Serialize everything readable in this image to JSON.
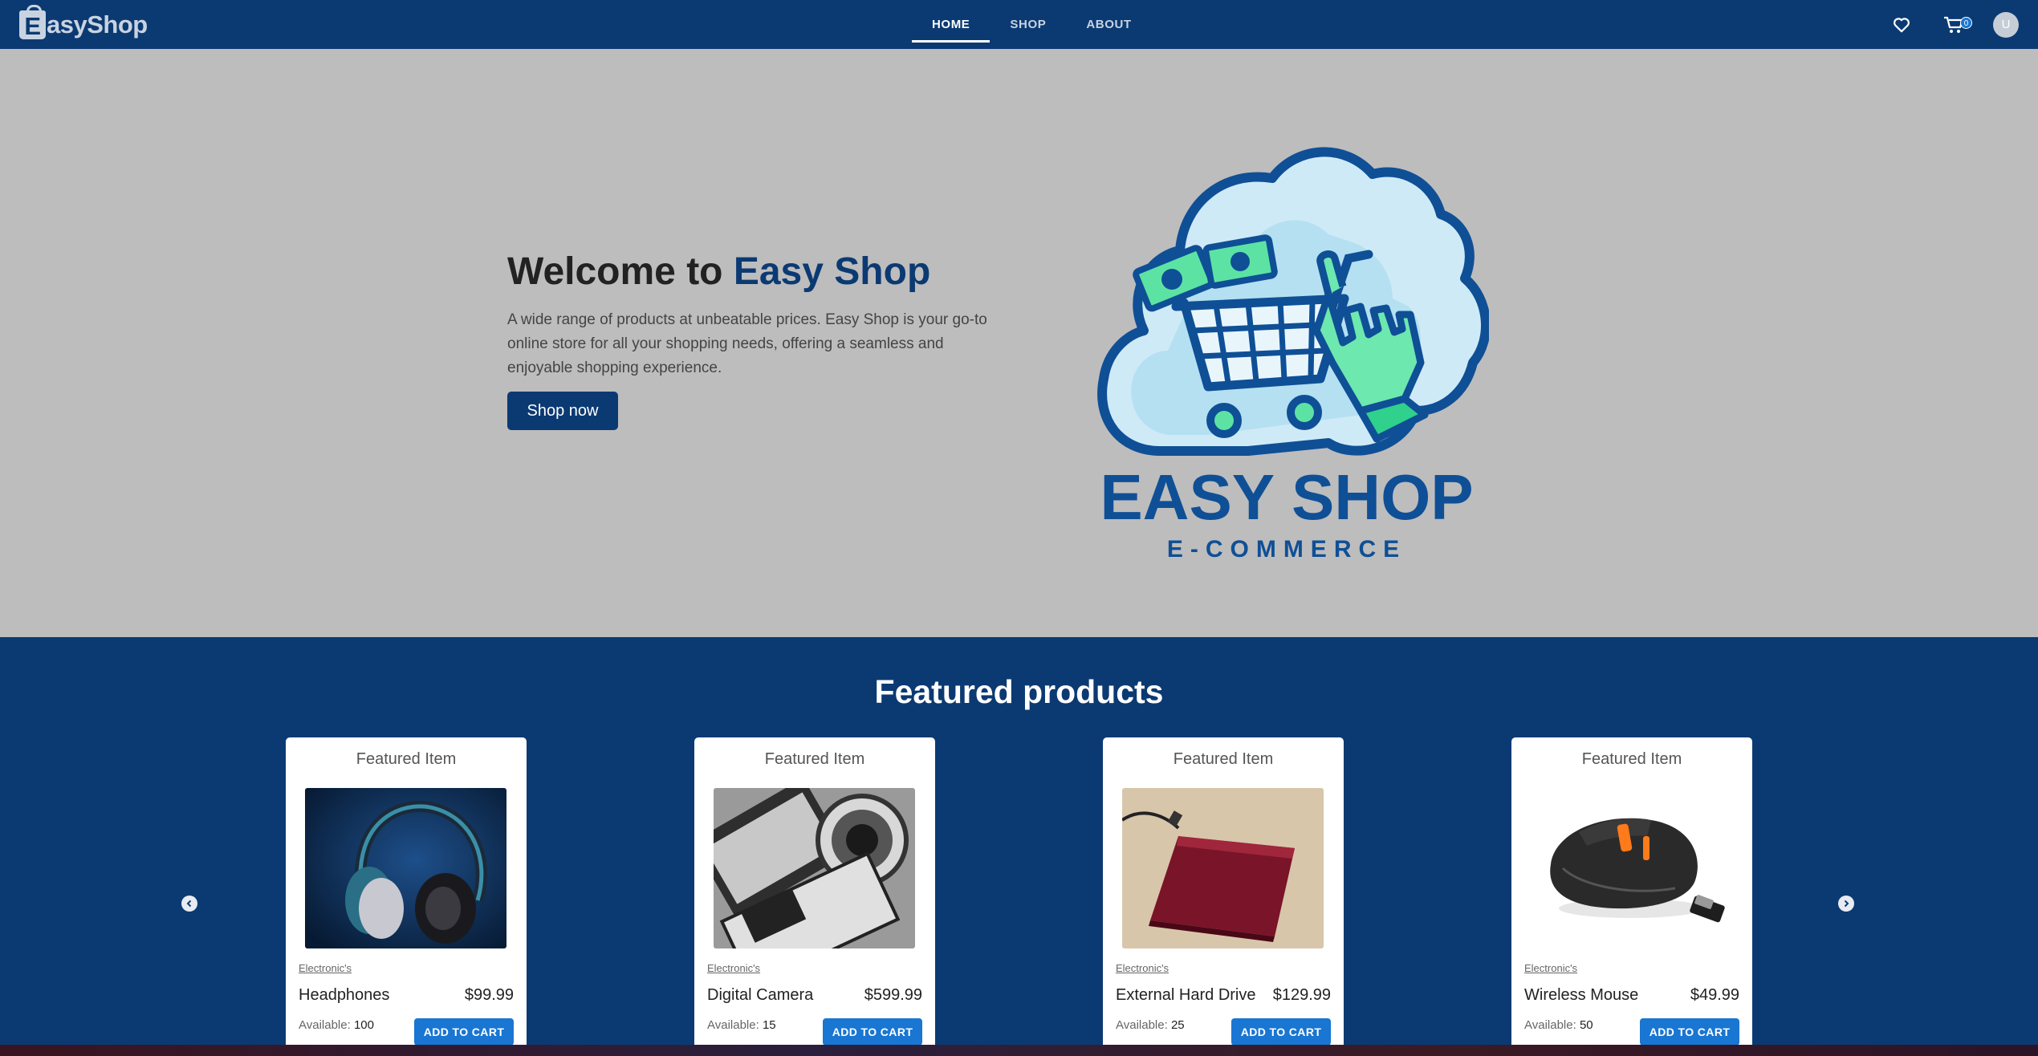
{
  "navbar": {
    "brand_initial": "E",
    "brand_text": "asyShop",
    "links": [
      {
        "label": "HOME",
        "active": true
      },
      {
        "label": "SHOP",
        "active": false
      },
      {
        "label": "ABOUT",
        "active": false
      }
    ],
    "wishlist_icon": "heart-icon",
    "cart_icon": "cart-icon",
    "cart_count": "0",
    "avatar_initial": "U"
  },
  "hero": {
    "title_prefix": "Welcome to ",
    "title_accent": "Easy Shop",
    "description": "A wide range of products at unbeatable prices. Easy Shop is your go-to online store for all your shopping needs, offering a seamless and enjoyable shopping experience.",
    "cta_label": "Shop now",
    "logo_title": "EASY SHOP",
    "logo_subtitle": "E-COMMERCE"
  },
  "featured": {
    "title": "Featured products",
    "prev_icon": "chevron-left-icon",
    "next_icon": "chevron-right-icon",
    "products": [
      {
        "header": "Featured Item",
        "category": "Electronic's",
        "name": "Headphones",
        "price": "$99.99",
        "available_label": "Available:",
        "available": "100",
        "cta": "ADD TO CART",
        "image": "headphones"
      },
      {
        "header": "Featured Item",
        "category": "Electronic's",
        "name": "Digital Camera",
        "price": "$599.99",
        "available_label": "Available:",
        "available": "15",
        "cta": "ADD TO CART",
        "image": "camera"
      },
      {
        "header": "Featured Item",
        "category": "Electronic's",
        "name": "External Hard Drive",
        "price": "$129.99",
        "available_label": "Available:",
        "available": "25",
        "cta": "ADD TO CART",
        "image": "hard-drive"
      },
      {
        "header": "Featured Item",
        "category": "Electronic's",
        "name": "Wireless Mouse",
        "price": "$49.99",
        "available_label": "Available:",
        "available": "50",
        "cta": "ADD TO CART",
        "image": "mouse"
      }
    ]
  },
  "colors": {
    "brand_navy": "#0b3a73",
    "hero_bg": "#bdbdbd",
    "button_blue": "#1976d2"
  }
}
